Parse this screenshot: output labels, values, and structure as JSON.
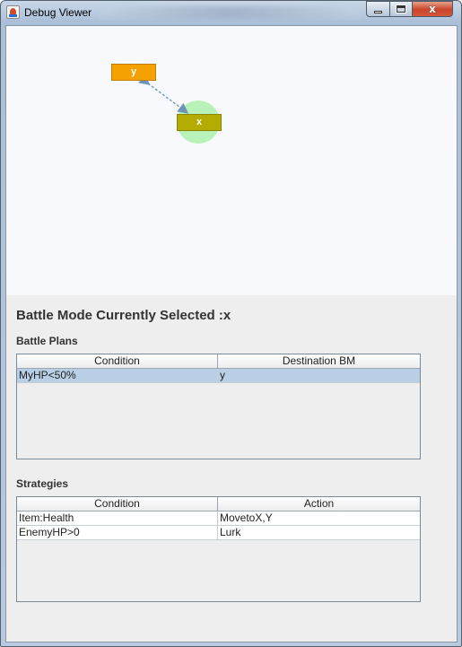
{
  "window": {
    "title": "Debug Viewer",
    "minimize_glyph": "_",
    "close_glyph": "x"
  },
  "graph": {
    "nodes": [
      {
        "id": "y",
        "label": "y",
        "color": "#f5a102"
      },
      {
        "id": "x",
        "label": "x",
        "color": "#b5ac02",
        "selected": true,
        "halo_color": "#b8f2b8"
      }
    ],
    "edge": {
      "from": "x",
      "to": "y",
      "bidirectional": true,
      "color": "#7a9cc0"
    }
  },
  "main": {
    "selected_heading": "Battle Mode Currently Selected :x",
    "plans_heading": "Battle Plans",
    "strategies_heading": "Strategies"
  },
  "battle_plans": {
    "columns": [
      "Condition",
      "Destination BM"
    ],
    "rows": [
      [
        "MyHP<50%",
        "y"
      ]
    ]
  },
  "strategies": {
    "columns": [
      "Condition",
      "Action"
    ],
    "rows": [
      [
        "Item:Health",
        "MovetoX,Y"
      ],
      [
        "EnemyHP>0",
        "Lurk"
      ]
    ]
  },
  "colors": {
    "selected_row": "#b8cfe5",
    "canvas_bg": "#f8f9fd",
    "panel_bg": "#eeeeee"
  }
}
